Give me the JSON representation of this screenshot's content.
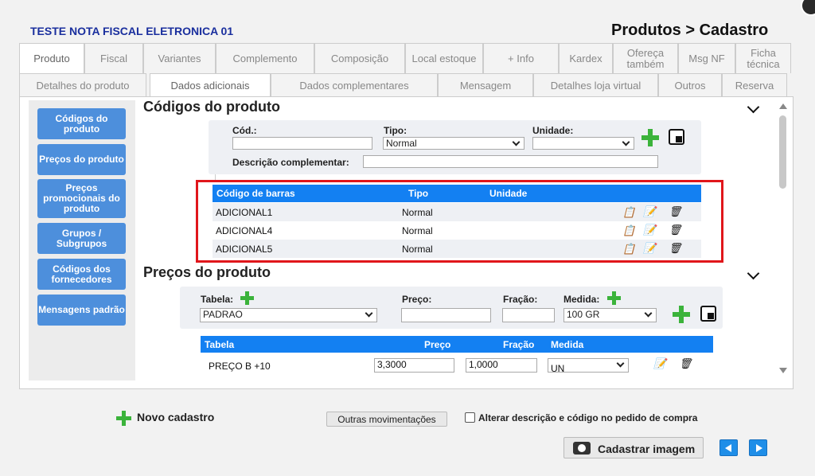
{
  "header": {
    "company": "TESTE NOTA FISCAL ELETRONICA 01",
    "breadcrumb": "Produtos > Cadastro"
  },
  "tabs": [
    {
      "label": "Produto"
    },
    {
      "label": "Fiscal"
    },
    {
      "label": "Variantes"
    },
    {
      "label": "Complemento"
    },
    {
      "label": "Composição"
    },
    {
      "label": "Local estoque"
    },
    {
      "label": "+ Info"
    },
    {
      "label": "Kardex"
    },
    {
      "label": "Ofereça também"
    },
    {
      "label": "Msg NF"
    },
    {
      "label": "Ficha técnica"
    }
  ],
  "subtabs": [
    {
      "label": "Detalhes do produto"
    },
    {
      "label": "Dados adicionais"
    },
    {
      "label": "Dados complementares"
    },
    {
      "label": "Mensagem"
    },
    {
      "label": "Detalhes loja virtual"
    },
    {
      "label": "Outros"
    },
    {
      "label": "Reserva"
    }
  ],
  "sidebar": {
    "items": [
      {
        "label": "Códigos do produto"
      },
      {
        "label": "Preços do produto"
      },
      {
        "label": "Preços promocionais do produto"
      },
      {
        "label": "Grupos / Subgrupos"
      },
      {
        "label": "Códigos dos fornecedores"
      },
      {
        "label": "Mensagens padrão"
      }
    ]
  },
  "codigos": {
    "title": "Códigos do produto",
    "form": {
      "cod_label": "Cód.:",
      "cod_value": "",
      "tipo_label": "Tipo:",
      "tipo_value": "Normal",
      "unidade_label": "Unidade:",
      "unidade_value": "",
      "desc_label": "Descrição complementar:",
      "desc_value": ""
    },
    "table": {
      "headers": [
        "Código de barras",
        "Tipo",
        "Unidade"
      ],
      "rows": [
        {
          "codigo": "ADICIONAL1",
          "tipo": "Normal",
          "unidade": ""
        },
        {
          "codigo": "ADICIONAL4",
          "tipo": "Normal",
          "unidade": ""
        },
        {
          "codigo": "ADICIONAL5",
          "tipo": "Normal",
          "unidade": ""
        }
      ]
    }
  },
  "precos": {
    "title": "Preços do produto",
    "form": {
      "tabela_label": "Tabela:",
      "tabela_value": "PADRAO",
      "preco_label": "Preço:",
      "preco_value": "",
      "fracao_label": "Fração:",
      "fracao_value": "",
      "medida_label": "Medida:",
      "medida_value": "100 GR"
    },
    "table": {
      "headers": [
        "Tabela",
        "Preço",
        "Fração",
        "Medida"
      ],
      "rows": [
        {
          "tabela": "PREÇO B +10",
          "preco": "3,3000",
          "fracao": "1,0000",
          "medida": "UN"
        }
      ]
    }
  },
  "footer": {
    "novo": "Novo cadastro",
    "outras": "Outras movimentações",
    "alterar": "Alterar descrição e código no pedido de compra",
    "cadastrar_imagem": "Cadastrar imagem"
  },
  "colors": {
    "accent": "#1380f2",
    "sidebar_button": "#4d8fdc",
    "highlight": "#e0161b",
    "add_green": "#3bb33b",
    "company_blue": "#1a2f9e"
  },
  "icons": [
    "clipboard-icon",
    "edit-icon",
    "trash-icon",
    "plus-icon",
    "camera-icon",
    "arrow-left-icon",
    "arrow-right-icon",
    "chevron-down-icon"
  ]
}
